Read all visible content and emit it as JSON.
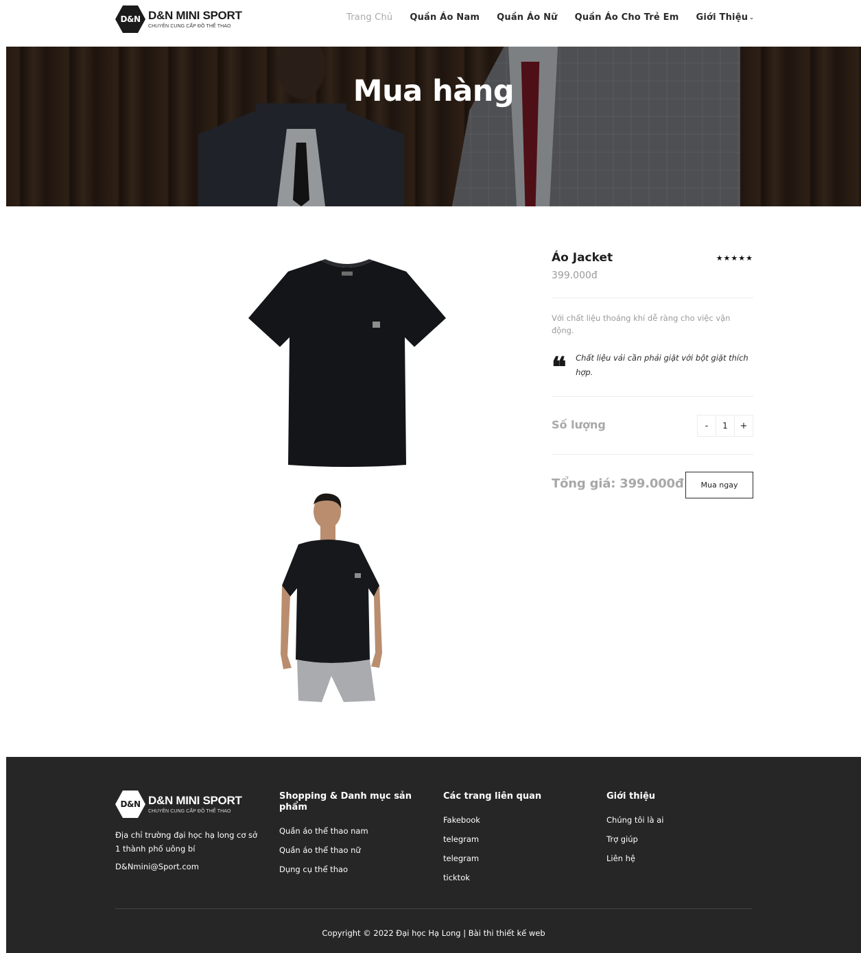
{
  "brand": {
    "hex_text": "D&N",
    "name": "D&N MINI SPORT",
    "tagline": "CHUYÊN CUNG CẤP ĐỒ THỂ THAO"
  },
  "nav": {
    "items": [
      {
        "label": "Trang Chủ",
        "active": true
      },
      {
        "label": "Quần Áo Nam"
      },
      {
        "label": "Quần Áo Nữ"
      },
      {
        "label": "Quần Áo Cho Trẻ Em"
      },
      {
        "label": "Giới Thiệu"
      }
    ]
  },
  "hero": {
    "title": "Mua hàng"
  },
  "product": {
    "name": "Áo Jacket",
    "rating": 5,
    "stars": "★★★★★",
    "price": "399.000đ",
    "description": "Với chất liệu thoáng khí dễ ràng cho việc vận động.",
    "quote": "Chất liệu vải cần phải giặt với bột giặt thích hợp.",
    "quantity_label": "Số lượng",
    "quantity": "1",
    "minus": "-",
    "plus": "+",
    "total": "Tổng giá: 399.000đ",
    "buy_label": "Mua ngay"
  },
  "footer": {
    "address": "Địa chỉ trường đại học hạ long cơ sở 1 thành phố uông bí",
    "email": "D&Nmini@Sport.com",
    "columns": [
      {
        "title": "Shopping & Danh mục sản phẩm",
        "links": [
          "Quần áo thể thao nam",
          "Quần áo thể thao nữ",
          "Dụng cụ thể thao"
        ]
      },
      {
        "title": "Các trang liên quan",
        "links": [
          "Fakebook",
          "telegram",
          "telegram",
          "ticktok"
        ]
      },
      {
        "title": "Giới thiệu",
        "links": [
          "Chúng tôi là ai",
          "Trợ giúp",
          "Liên hệ"
        ]
      }
    ],
    "copyright": "Copyright © 2022 Đại học Hạ Long | Bài thi thiết kế web"
  },
  "colors": {
    "footer_bg": "#262626",
    "muted_text": "#9a9a9a",
    "dark_text": "#1e1e1e"
  }
}
